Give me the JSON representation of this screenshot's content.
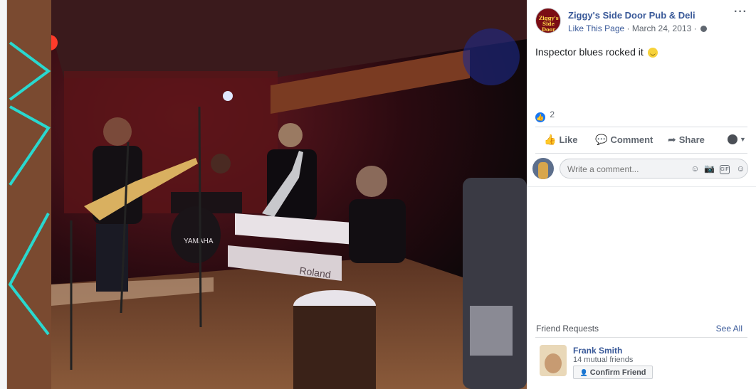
{
  "post": {
    "page_name": "Ziggy's Side Door Pub & Deli",
    "avatar_text": "Ziggy's Side Door",
    "like_page": "Like This Page",
    "separator": "·",
    "date": "March 24, 2013",
    "more": "···",
    "text": "Inspector blues rocked it",
    "reaction_count": "2"
  },
  "actions": {
    "like": "Like",
    "comment": "Comment",
    "share": "Share"
  },
  "comment": {
    "placeholder": "Write a comment...",
    "gif": "GIF"
  },
  "friend_requests": {
    "title": "Friend Requests",
    "see_all": "See All",
    "name": "Frank Smith",
    "mutual": "14 mutual friends",
    "confirm": "Confirm Friend"
  },
  "photo": {
    "drum_brand": "YAMAHA",
    "keyboard_brand": "Roland"
  },
  "colors": {
    "link": "#385898",
    "accent": "#1877f2"
  }
}
